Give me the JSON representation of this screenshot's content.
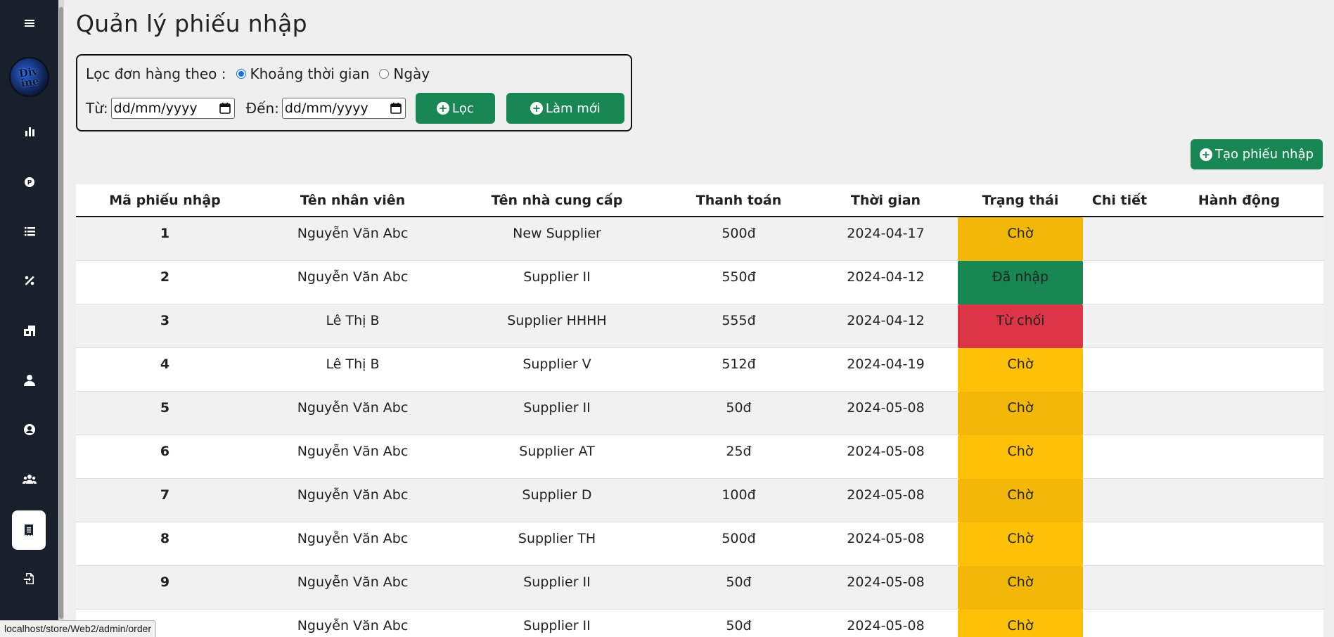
{
  "page_title": "Quản lý phiếu nhập",
  "filter": {
    "label": "Lọc đơn hàng theo :",
    "option_range": "Khoảng thời gian",
    "option_day": "Ngày",
    "selected": "range",
    "from_label": "Từ:",
    "to_label": "Đến:",
    "from_placeholder": "dd/mm/yyyy",
    "to_placeholder": "dd/mm/yyyy",
    "filter_button": "Lọc",
    "reset_button": "Làm mới"
  },
  "create_button": "Tạo phiếu nhập",
  "table": {
    "headers": [
      "Mã phiếu nhập",
      "Tên nhân viên",
      "Tên nhà cung cấp",
      "Thanh toán",
      "Thời gian",
      "Trạng thái",
      "Chi tiết",
      "Hành động"
    ],
    "rows": [
      {
        "id": "1",
        "employee": "Nguyễn Văn Abc",
        "supplier": "New Supplier",
        "payment": "500đ",
        "time": "2024-04-17",
        "status": "Chờ",
        "status_type": "pending"
      },
      {
        "id": "2",
        "employee": "Nguyễn Văn Abc",
        "supplier": "Supplier II",
        "payment": "550đ",
        "time": "2024-04-12",
        "status": "Đã nhập",
        "status_type": "done"
      },
      {
        "id": "3",
        "employee": "Lê Thị B",
        "supplier": "Supplier HHHH",
        "payment": "555đ",
        "time": "2024-04-12",
        "status": "Từ chối",
        "status_type": "reject"
      },
      {
        "id": "4",
        "employee": "Lê Thị B",
        "supplier": "Supplier V",
        "payment": "512đ",
        "time": "2024-04-19",
        "status": "Chờ",
        "status_type": "pending"
      },
      {
        "id": "5",
        "employee": "Nguyễn Văn Abc",
        "supplier": "Supplier II",
        "payment": "50đ",
        "time": "2024-05-08",
        "status": "Chờ",
        "status_type": "pending"
      },
      {
        "id": "6",
        "employee": "Nguyễn Văn Abc",
        "supplier": "Supplier AT",
        "payment": "25đ",
        "time": "2024-05-08",
        "status": "Chờ",
        "status_type": "pending"
      },
      {
        "id": "7",
        "employee": "Nguyễn Văn Abc",
        "supplier": "Supplier D",
        "payment": "100đ",
        "time": "2024-05-08",
        "status": "Chờ",
        "status_type": "pending"
      },
      {
        "id": "8",
        "employee": "Nguyễn Văn Abc",
        "supplier": "Supplier TH",
        "payment": "500đ",
        "time": "2024-05-08",
        "status": "Chờ",
        "status_type": "pending"
      },
      {
        "id": "9",
        "employee": "Nguyễn Văn Abc",
        "supplier": "Supplier II",
        "payment": "50đ",
        "time": "2024-05-08",
        "status": "Chờ",
        "status_type": "pending"
      },
      {
        "id": "",
        "employee": "Nguyễn Văn Abc",
        "supplier": "Supplier II",
        "payment": "50đ",
        "time": "2024-05-08",
        "status": "Chờ",
        "status_type": "pending"
      }
    ]
  },
  "statusbar_url": "localhost/store/Web2/admin/order",
  "sidebar": {
    "items": [
      "menu-icon",
      "chart-icon",
      "coin-icon",
      "list-icon",
      "percent-icon",
      "warehouse-icon",
      "user-icon",
      "user-circle-icon",
      "users-icon",
      "receipt-icon",
      "logout-icon"
    ],
    "active": "receipt-icon",
    "avatar_text": "Div ine"
  },
  "colors": {
    "sidebar": "#17202b",
    "green": "#198754",
    "pending": "#ffc107",
    "reject": "#dc3545"
  }
}
